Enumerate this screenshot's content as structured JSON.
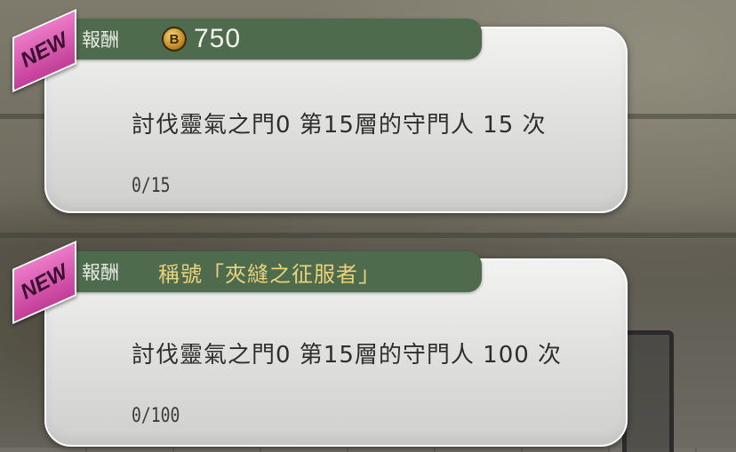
{
  "colors": {
    "card_bg": "#e6e6e4",
    "reward_header_bg": "#4f6b4d",
    "reward_title_color": "#e9d27a",
    "new_badge": "#d955ad",
    "coin": "#c48b24"
  },
  "quests": [
    {
      "badge": "NEW",
      "reward_label": "報酬",
      "reward_icon": "bronze-coin-icon",
      "coin_letter": "B",
      "reward_value": "750",
      "description": "討伐靈氣之門0 第15層的守門人 15 次",
      "progress": "0/15"
    },
    {
      "badge": "NEW",
      "reward_label": "報酬",
      "reward_value": "稱號「夾縫之征服者」",
      "description": "討伐靈氣之門0 第15層的守門人 100 次",
      "progress": "0/100"
    }
  ]
}
